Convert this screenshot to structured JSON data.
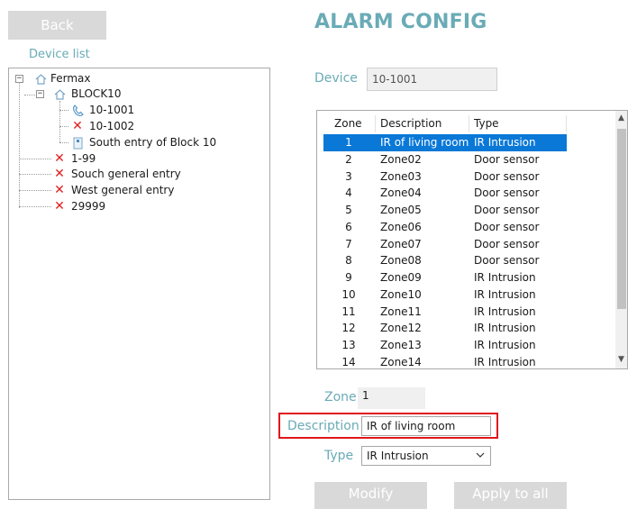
{
  "toolbar": {
    "back_label": "Back"
  },
  "sidebar": {
    "title": "Device list",
    "tree": {
      "root": "Fermax",
      "block": "BLOCK10",
      "block_children": [
        "10-1001",
        "10-1002",
        "South entry of Block 10"
      ],
      "root_children": [
        "1-99",
        "Souch general entry",
        "West general entry",
        "29999"
      ]
    }
  },
  "main": {
    "title": "ALARM CONFIG",
    "device_label": "Device",
    "device_value": "10-1001",
    "table": {
      "columns": [
        "Zone",
        "Description",
        "Type"
      ],
      "rows": [
        [
          "1",
          "IR of living room",
          "IR Intrusion"
        ],
        [
          "2",
          "Zone02",
          "Door sensor"
        ],
        [
          "3",
          "Zone03",
          "Door sensor"
        ],
        [
          "4",
          "Zone04",
          "Door sensor"
        ],
        [
          "5",
          "Zone05",
          "Door sensor"
        ],
        [
          "6",
          "Zone06",
          "Door sensor"
        ],
        [
          "7",
          "Zone07",
          "Door sensor"
        ],
        [
          "8",
          "Zone08",
          "Door sensor"
        ],
        [
          "9",
          "Zone09",
          "IR Intrusion"
        ],
        [
          "10",
          "Zone10",
          "IR Intrusion"
        ],
        [
          "11",
          "Zone11",
          "IR Intrusion"
        ],
        [
          "12",
          "Zone12",
          "IR Intrusion"
        ],
        [
          "13",
          "Zone13",
          "IR Intrusion"
        ],
        [
          "14",
          "Zone14",
          "IR Intrusion"
        ]
      ],
      "selected_row": 0
    },
    "zone_label": "Zone",
    "zone_value": "1",
    "description_label": "Description",
    "description_value": "IR of living room",
    "type_label": "Type",
    "type_value": "IR Intrusion",
    "modify_label": "Modify",
    "apply_all_label": "Apply to all"
  },
  "colors": {
    "accent": "#6aabb6",
    "selection": "#0a78d7",
    "highlight_border": "#e0161b",
    "error_icon": "#e02020",
    "button_bg": "#d9d9d9"
  }
}
